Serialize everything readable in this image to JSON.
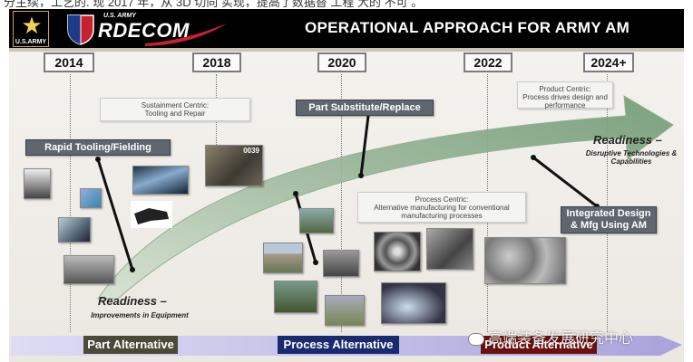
{
  "caption_top": "分主续，工艺的. 现 2017 年，从 3D 切向 实现，提高了数据替 工程 大的 不可 。",
  "header": {
    "army_logo_text": "U.S.ARMY",
    "rdecom_small": "U.S. ARMY",
    "rdecom_name": "RDECOM",
    "title": "OPERATIONAL APPROACH FOR ARMY AM",
    "colors": {
      "header_bg": "#000000",
      "swoosh": "#c8202f"
    }
  },
  "timeline": {
    "years": [
      "2014",
      "2018",
      "2020",
      "2022",
      "2024+"
    ]
  },
  "labels": {
    "rapid_tooling": "Rapid Tooling/Fielding",
    "part_substitute": "Part Substitute/Replace",
    "integrated_design": "Integrated Design\n& Mfg Using AM"
  },
  "notes": {
    "sustainment": "Sustainment Centric:\nTooling and Repair",
    "process": "Process Centric:\nAlternative manufacturing for conventional\nmanufacturing processes",
    "product": "Product Centric:\nProcess drives design and\nperformance"
  },
  "readiness": {
    "left_title": "Readiness –",
    "left_sub": "Improvements in Equipment",
    "right_title": "Readiness –",
    "right_sub": "Disruptive Technologies &\nCapabilities"
  },
  "photos": {
    "p2018": "0039"
  },
  "phases": {
    "part": "Part Alternative",
    "process": "Process Alternative",
    "product": "Product Alternative",
    "colors": {
      "part": "#4a4a38",
      "process": "#1a2a70",
      "product": "#6a1010",
      "bar": "#c8c6e8"
    }
  },
  "watermark": "高端装备发展研究中心"
}
